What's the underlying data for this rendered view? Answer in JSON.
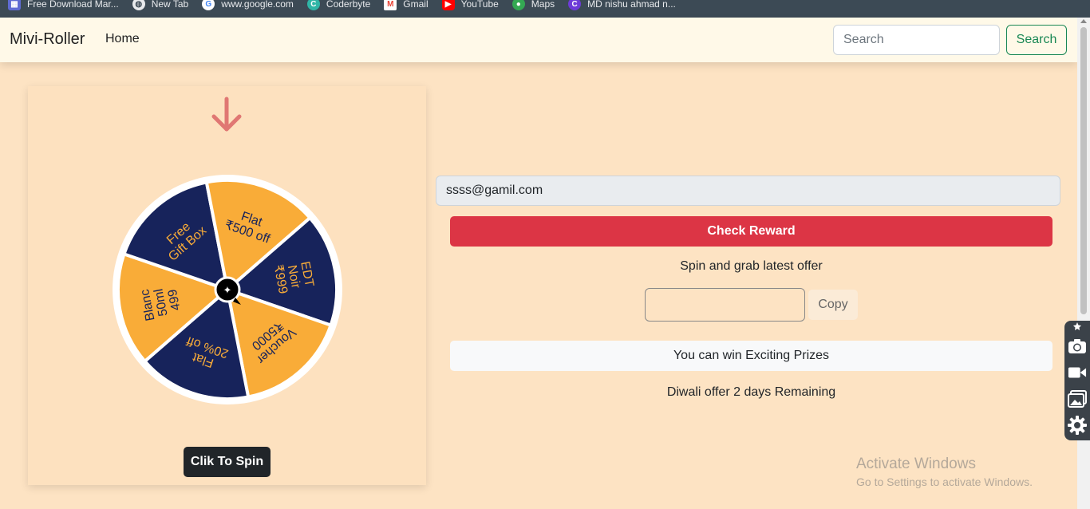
{
  "bookmarks": [
    {
      "label": "Free Download Mar...",
      "icon": "film-icon",
      "color": "#5f6bd3"
    },
    {
      "label": "New Tab",
      "icon": "globe-icon",
      "color": "#e8eaed"
    },
    {
      "label": "www.google.com",
      "icon": "google-icon",
      "color": "#ffffff"
    },
    {
      "label": "Coderbyte",
      "icon": "coderbyte-icon",
      "color": "#2fb5a6"
    },
    {
      "label": "Gmail",
      "icon": "gmail-icon",
      "color": "#ea4335"
    },
    {
      "label": "YouTube",
      "icon": "youtube-icon",
      "color": "#ff0000"
    },
    {
      "label": "Maps",
      "icon": "maps-pin-icon",
      "color": "#34a853"
    },
    {
      "label": "MD nishu ahmad n...",
      "icon": "canva-icon",
      "color": "#6d3bd8"
    }
  ],
  "navbar": {
    "brand": "Mivi-Roller",
    "home": "Home",
    "search_placeholder": "Search",
    "search_button": "Search"
  },
  "wheel": {
    "segments": [
      {
        "text": "Blanc\n50ml\n499",
        "color": "#f9ac38"
      },
      {
        "text": "Free\nGift Box",
        "color": "#17235b"
      },
      {
        "text": "Flat\n₹500 off",
        "color": "#f9ac38"
      },
      {
        "text": "EDT\nNoir\n₹999",
        "color": "#17235b"
      },
      {
        "text": "Voucher\n₹5000",
        "color": "#f9ac38"
      },
      {
        "text": "Flat\n20% off",
        "color": "#17235b"
      }
    ],
    "pointer_color": "#e07773",
    "spin_button": "Clik To Spin"
  },
  "reward": {
    "email_value": "ssss@gamil.com",
    "check_button": "Check Reward",
    "spin_text": "Spin and grab latest offer",
    "code_value": "",
    "copy_button": "Copy",
    "prize_text": "You can win Exciting Prizes",
    "offer_text": "Diwali offer 2 days Remaining"
  },
  "watermark": {
    "title": "Activate Windows",
    "subtitle": "Go to Settings to activate Windows."
  },
  "colors": {
    "page_bg": "#fde3c3",
    "navbar_bg": "#fff9e8",
    "danger": "#dc3545",
    "success": "#198754"
  }
}
